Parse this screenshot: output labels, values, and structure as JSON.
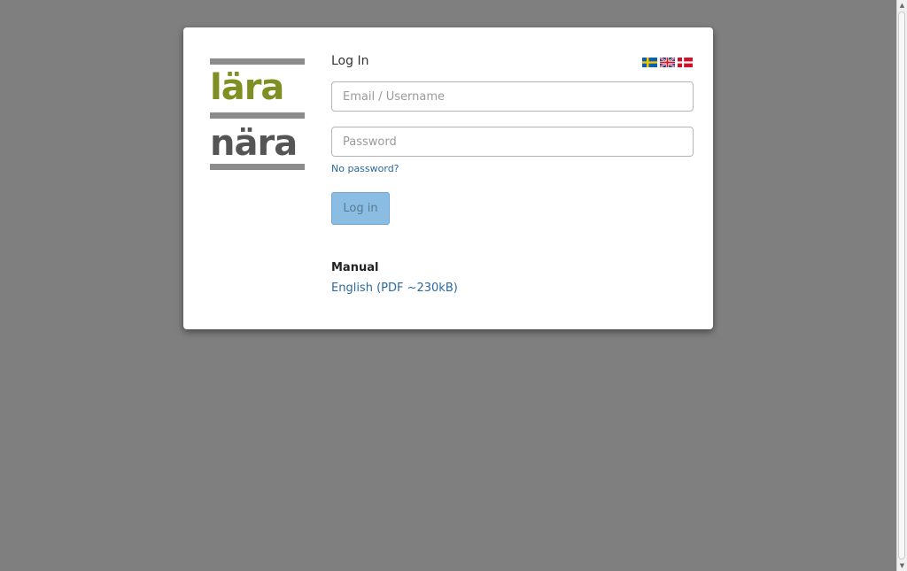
{
  "logo": {
    "line1": "lära",
    "line2": "nära"
  },
  "login": {
    "title": "Log In",
    "email_placeholder": "Email / Username",
    "password_placeholder": "Password",
    "forgot_link": "No password?",
    "submit_label": "Log in"
  },
  "languages": [
    {
      "name": "swedish-flag-icon"
    },
    {
      "name": "uk-flag-icon"
    },
    {
      "name": "danish-flag-icon"
    }
  ],
  "manual": {
    "title": "Manual",
    "link": "English (PDF ~230kB)"
  },
  "colors": {
    "background": "#7f7f7f",
    "logo_green": "#7f8f24",
    "logo_gray": "#555555",
    "link": "#2a6aa0",
    "button": "#8bbde3"
  }
}
